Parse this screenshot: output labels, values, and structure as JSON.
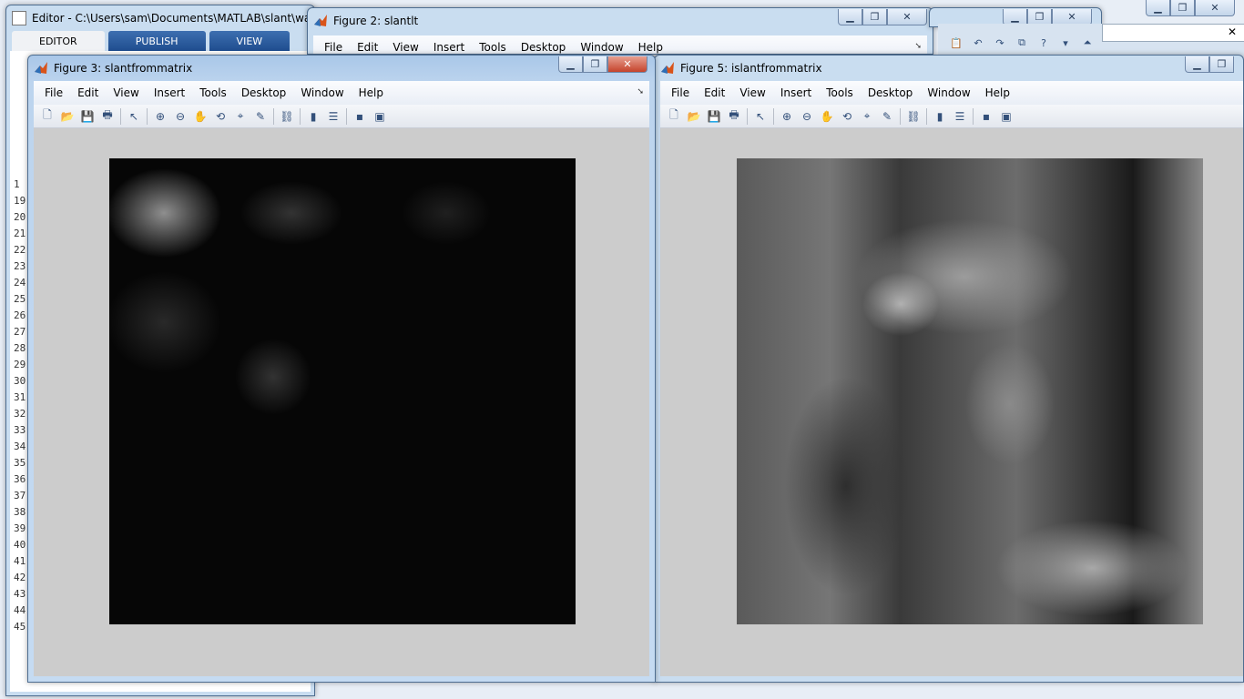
{
  "editor": {
    "title": "Editor - C:\\Users\\sam\\Documents\\MATLAB\\slant\\waterm",
    "tabs": [
      "EDITOR",
      "PUBLISH",
      "VIEW"
    ],
    "line_numbers": [
      "1",
      "19",
      "20",
      "21",
      "22",
      "23",
      "24",
      "25",
      "26",
      "27",
      "28",
      "29",
      "30",
      "31",
      "32",
      "33",
      "34",
      "35",
      "36",
      "37",
      "38",
      "39",
      "40",
      "41",
      "42",
      "43",
      "44",
      "45"
    ]
  },
  "figure2": {
    "title": "Figure 2: slantlt",
    "menus": [
      "File",
      "Edit",
      "View",
      "Insert",
      "Tools",
      "Desktop",
      "Window",
      "Help"
    ]
  },
  "figure3": {
    "title": "Figure 3: slantfrommatrix",
    "menus": [
      "File",
      "Edit",
      "View",
      "Insert",
      "Tools",
      "Desktop",
      "Window",
      "Help"
    ]
  },
  "figure5": {
    "title": "Figure 5: islantfrommatrix",
    "menus": [
      "File",
      "Edit",
      "View",
      "Insert",
      "Tools",
      "Desktop",
      "Window",
      "Help"
    ]
  },
  "toolbar_icons": [
    "new-figure-icon",
    "open-file-icon",
    "save-icon",
    "print-icon",
    "select-arrow-icon",
    "zoom-in-icon",
    "zoom-out-icon",
    "pan-hand-icon",
    "rotate-3d-icon",
    "data-cursor-icon",
    "brush-icon",
    "link-plot-icon",
    "colorbar-icon",
    "legend-icon",
    "hide-plot-tools-icon",
    "show-plot-tools-icon"
  ],
  "colors": {
    "matlab_logo": "#d95319",
    "title_active": "#a9c7e8",
    "figure_bg": "#cccccc",
    "close_red": "#c4432c"
  }
}
